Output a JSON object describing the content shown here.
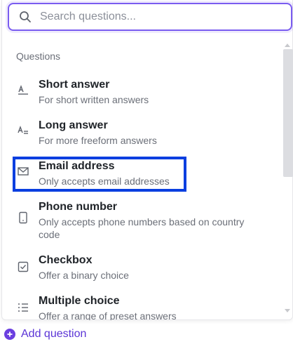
{
  "search": {
    "placeholder": "Search questions..."
  },
  "section_label": "Questions",
  "items": [
    {
      "title": "Short answer",
      "desc": "For short written answers",
      "icon": "short-answer-icon"
    },
    {
      "title": "Long answer",
      "desc": "For more freeform answers",
      "icon": "long-answer-icon"
    },
    {
      "title": "Email address",
      "desc": "Only accepts email addresses",
      "icon": "email-icon"
    },
    {
      "title": "Phone number",
      "desc_line1": "Only accepts phone numbers based on country",
      "desc_line2": "code",
      "icon": "phone-icon"
    },
    {
      "title": "Checkbox",
      "desc": "Offer a binary choice",
      "icon": "checkbox-icon"
    },
    {
      "title": "Multiple choice",
      "desc": "Offer a range of preset answers",
      "icon": "list-icon"
    }
  ],
  "add_question": {
    "label": "Add question"
  },
  "colors": {
    "accent": "#7a5cf0",
    "highlight": "#0a3fe0",
    "link": "#5b34d6"
  }
}
